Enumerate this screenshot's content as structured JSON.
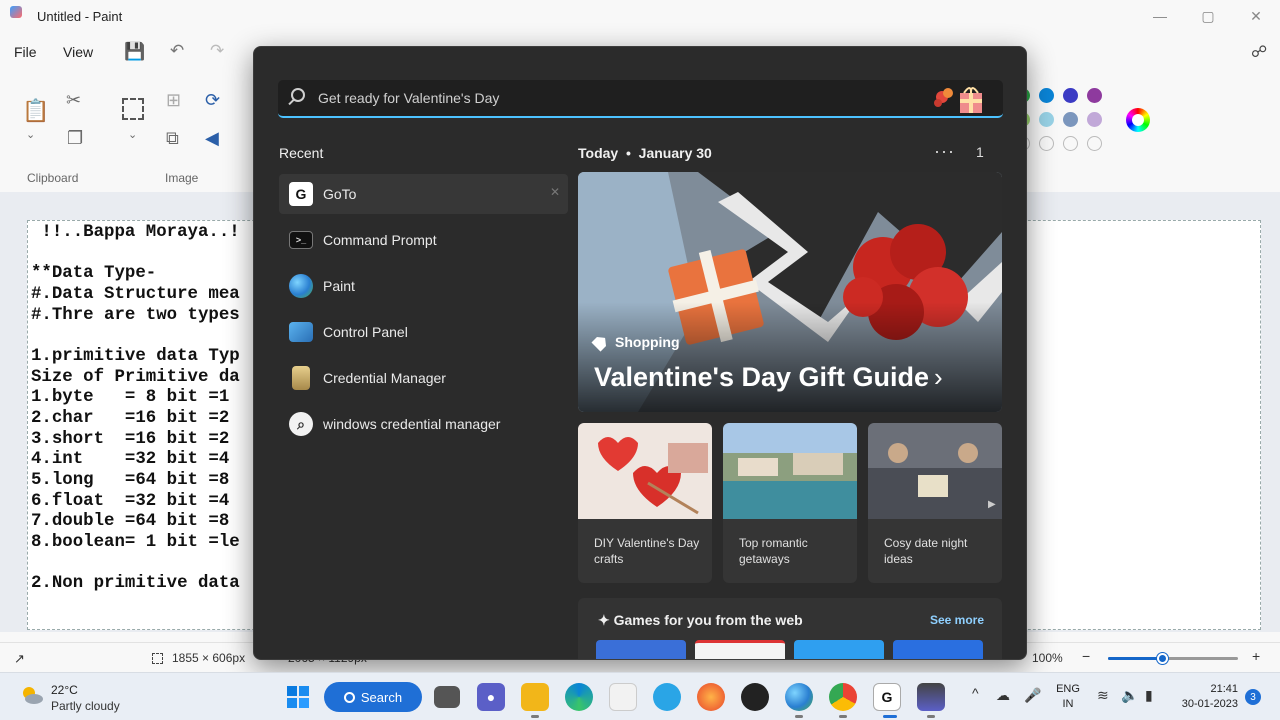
{
  "window": {
    "title": "Untitled - Paint",
    "minimize": "—",
    "maximize": "▢",
    "close": "✕"
  },
  "menu": {
    "file": "File",
    "view": "View"
  },
  "ribbon": {
    "clipboard_label": "Clipboard",
    "image_label": "Image"
  },
  "canvas": {
    "lines": [
      " !!..Bappa Moraya..!",
      "",
      "**Data Type-",
      "#.Data Structure mea",
      "#.Thre are two types",
      "",
      "1.primitive data Typ",
      "Size of Primitive da",
      "1.byte   = 8 bit =1",
      "2.char   =16 bit =2",
      "3.short  =16 bit =2",
      "4.int    =32 bit =4",
      "5.long   =64 bit =8",
      "6.float  =32 bit =4",
      "7.double =64 bit =8",
      "8.boolean= 1 bit =le",
      "",
      "2.Non primitive data"
    ]
  },
  "status": {
    "selection_size": "1855 × 606px",
    "canvas_size": "2065 × 1129px",
    "zoom": "100%",
    "zoom_fraction": 0.42
  },
  "flyout": {
    "search_placeholder": "Get ready for Valentine's Day",
    "recent_heading": "Recent",
    "recent": [
      {
        "label": "GoTo",
        "icon": "goto-icon",
        "glyph": "G"
      },
      {
        "label": "Command Prompt",
        "icon": "command-prompt-icon",
        "glyph": ">_"
      },
      {
        "label": "Paint",
        "icon": "paint-icon",
        "glyph": ""
      },
      {
        "label": "Control Panel",
        "icon": "control-panel-icon",
        "glyph": ""
      },
      {
        "label": "Credential Manager",
        "icon": "credential-manager-icon",
        "glyph": ""
      },
      {
        "label": "windows credential manager",
        "icon": "search-icon",
        "glyph": "⌕"
      }
    ],
    "today": "Today",
    "date": "January 30",
    "more": "···",
    "count": "1",
    "hero": {
      "tag": "Shopping",
      "title": "Valentine's Day Gift Guide",
      "chevron": "›"
    },
    "cards": [
      {
        "text": "DIY Valentine's Day crafts"
      },
      {
        "text": "Top romantic getaways"
      },
      {
        "text": "Cosy date night ideas"
      }
    ],
    "games": {
      "title": "Games for you from the web",
      "see_more": "See more"
    }
  },
  "taskbar": {
    "weather_temp": "22°C",
    "weather_desc": "Partly cloudy",
    "search_label": "Search",
    "lang_top": "ENG",
    "lang_bottom": "IN",
    "time": "21:41",
    "date": "30-01-2023",
    "notifications": "3",
    "tray_chevron": "^"
  },
  "colors": {
    "accent": "#4cc2ff",
    "flyout_bg": "#2b2b2b",
    "taskbar_bg": "#e9eef5"
  }
}
